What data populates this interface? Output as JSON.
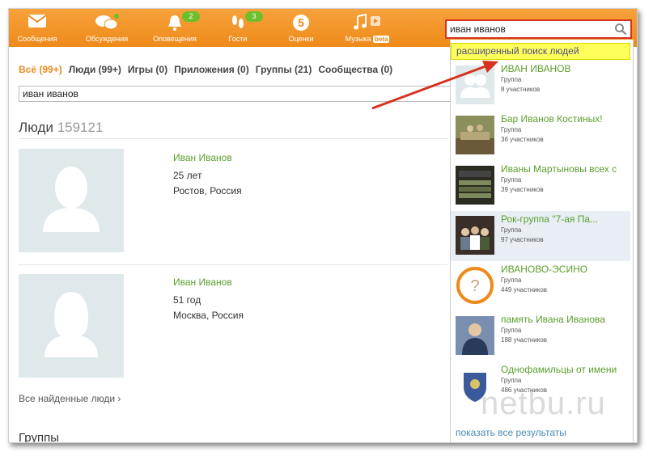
{
  "nav": [
    {
      "label": "Сообщения",
      "icon": "envelope-icon"
    },
    {
      "label": "Обсуждения",
      "icon": "chat-bubbles-icon"
    },
    {
      "label": "Оповещения",
      "icon": "bell-icon",
      "badge": "2"
    },
    {
      "label": "Гости",
      "icon": "footprints-icon",
      "badge": "3"
    },
    {
      "label": "Оценки",
      "icon": "five-rating-icon"
    },
    {
      "label": "Музыка",
      "beta": "beta",
      "icon": "music-note-icon"
    }
  ],
  "search": {
    "value": "иван иванов",
    "advanced_label": "расширенный поиск людей"
  },
  "filters": [
    "Всё (99+)",
    "Люди (99+)",
    "Игры (0)",
    "Приложения (0)",
    "Группы (21)",
    "Сообщества (0)"
  ],
  "query": "иван иванов",
  "people_section": {
    "title": "Люди",
    "count": "159121"
  },
  "people": [
    {
      "name": "Иван Иванов",
      "age": "25 лет",
      "location": "Ростов, Россия"
    },
    {
      "name": "Иван Иванов",
      "age": "51 год",
      "location": "Москва, Россия"
    }
  ],
  "all_people_link": "Все найденные люди ›",
  "groups": [
    {
      "name": "ИВАН ИВАНОВ",
      "type": "Группа",
      "members": "8 участников"
    },
    {
      "name": "Бар Иванов Костиных!",
      "type": "Группа",
      "members": "36 участников"
    },
    {
      "name": "Иваны Мартыновы всех с",
      "type": "Группа",
      "members": "39 участников"
    },
    {
      "name": "Рок-группа \"7-ая Па...",
      "type": "Группа",
      "members": "97 участников"
    },
    {
      "name": "ИВАНОВО-ЭСИНО",
      "type": "Группа",
      "members": "449 участников"
    },
    {
      "name": "память Ивана Иванова",
      "type": "Группа",
      "members": "188 участников"
    },
    {
      "name": "Однофамильцы от имени",
      "type": "Группа",
      "members": "486 участников"
    }
  ],
  "show_all_label": "показать все результаты",
  "bottom_cut_text": "Группы",
  "watermark": "netbu.ru",
  "colors": {
    "brand": "#ee8a19",
    "link_green": "#5c9e2d",
    "highlight_yellow": "#ffff5a",
    "annotation_red": "#d6331f"
  }
}
